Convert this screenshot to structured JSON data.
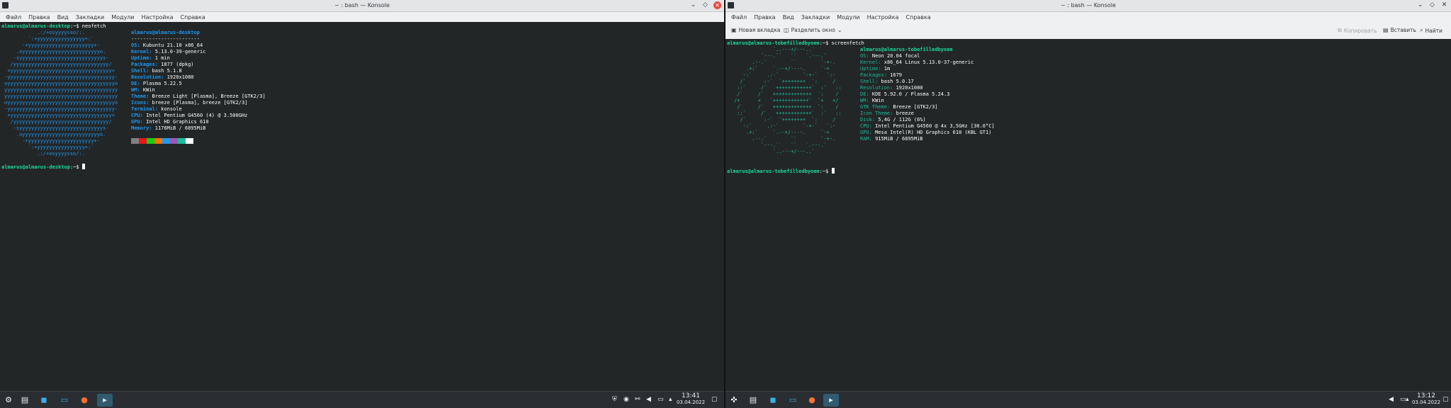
{
  "left_window": {
    "title": "~ : bash — Konsole",
    "menu": [
      "Файл",
      "Правка",
      "Вид",
      "Закладки",
      "Модули",
      "Настройка",
      "Справка"
    ],
    "prompt_user": "almarus@almarus-desktop",
    "prompt_suffix": ":~$ ",
    "command": "neofetch",
    "header_user": "almarus@almarus-desktop",
    "separator": "-----------------------",
    "info": [
      {
        "key": "OS",
        "value": "Kubuntu 21.10 x86_64"
      },
      {
        "key": "Kernel",
        "value": "5.13.0-39-generic"
      },
      {
        "key": "Uptime",
        "value": "1 min"
      },
      {
        "key": "Packages",
        "value": "1877 (dpkg)"
      },
      {
        "key": "Shell",
        "value": "bash 5.1.8"
      },
      {
        "key": "Resolution",
        "value": "1920x1080"
      },
      {
        "key": "DE",
        "value": "Plasma 5.22.5"
      },
      {
        "key": "WM",
        "value": "KWin"
      },
      {
        "key": "Theme",
        "value": "Breeze Light [Plasma], Breeze [GTK2/3]"
      },
      {
        "key": "Icons",
        "value": "breeze [Plasma], breeze [GTK2/3]"
      },
      {
        "key": "Terminal",
        "value": "konsole"
      },
      {
        "key": "CPU",
        "value": "Intel Pentium G4560 (4) @ 3.500GHz"
      },
      {
        "key": "GPU",
        "value": "Intel HD Graphics 610"
      },
      {
        "key": "Memory",
        "value": "1176MiB / 6895MiB"
      }
    ],
    "ascii_art": [
      "           .:/+osyyyysso/:.",
      "        `:+yyyyyyyyyyyyyyyy+:`",
      "      -+yyyyyyyyyyyyyyyyyyyyyy+-",
      "    .oyyyyyyyyyyyyyyyyyyyyyyyyyyo.",
      "   -syyyyyyyyyyyyyyyyyyyyyyyyyyyys-",
      "  /yyyyyyyyyyyyyyyyyyyyyyyyyyyyyyyy/",
      " +yyyyyyyyyyyyyyyyyyyyyyyyyyyyyyyyyy+",
      "-yyyyyyyyyyyyyyyyyyyyyyyyyyyyyyyyyyyy-",
      "oyyyyyyyyyyyyyyyyyyyyyyyyyyyyyyyyyyyyo",
      "yyyyyyyyyyyyyyyyyyyyyyyyyyyyyyyyyyyyyy",
      "yyyyyyyyyyyyyyyyyyyyyyyyyyyyyyyyyyyyyy",
      "oyyyyyyyyyyyyyyyyyyyyyyyyyyyyyyyyyyyyo",
      "-yyyyyyyyyyyyyyyyyyyyyyyyyyyyyyyyyyyy-",
      " +yyyyyyyyyyyyyyyyyyyyyyyyyyyyyyyyyy+",
      "  /yyyyyyyyyyyyyyyyyyyyyyyyyyyyyyyy/",
      "   -syyyyyyyyyyyyyyyyyyyyyyyyyyyys-",
      "    .oyyyyyyyyyyyyyyyyyyyyyyyyyyo.",
      "      -+yyyyyyyyyyyyyyyyyyyyyy+-",
      "        `:+yyyyyyyyyyyyyyyy+:`",
      "           .:/+osyyyysso/:."
    ],
    "palette": [
      "#808080",
      "#ed1515",
      "#11d116",
      "#f67400",
      "#1d99f3",
      "#9b59b6",
      "#1abc9c",
      "#fcfcfc"
    ]
  },
  "right_window": {
    "title": "~ : bash — Konsole",
    "menu": [
      "Файл",
      "Правка",
      "Вид",
      "Закладки",
      "Модули",
      "Настройка",
      "Справка"
    ],
    "toolbar": {
      "new_tab": "Новая вкладка",
      "split": "Разделить окно",
      "copy": "Копировать",
      "paste": "Вставить",
      "find": "Найти"
    },
    "prompt_user": "almarus@almarus-tobefilledbyoem",
    "prompt_suffix": ":~$ ",
    "command": "screenfetch",
    "header_user": "almarus@almarus-tobefilledbyoem",
    "info": [
      {
        "key": "OS",
        "value": "Neon 20.04 focal"
      },
      {
        "key": "Kernel",
        "value": "x86_64 Linux 5.13.0-37-generic"
      },
      {
        "key": "Uptime",
        "value": "1m"
      },
      {
        "key": "Packages",
        "value": "1679"
      },
      {
        "key": "Shell",
        "value": "bash 5.0.17"
      },
      {
        "key": "Resolution",
        "value": "1920x1080"
      },
      {
        "key": "DE",
        "value": "KDE 5.92.0 / Plasma 5.24.3"
      },
      {
        "key": "WM",
        "value": "KWin"
      },
      {
        "key": "GTK Theme",
        "value": "Breeze [GTK2/3]"
      },
      {
        "key": "Icon Theme",
        "value": "breeze"
      },
      {
        "key": "Disk",
        "value": "5,4G / 112G (6%)"
      },
      {
        "key": "CPU",
        "value": "Intel Pentium G4560 @ 4x 3,5GHz [30.0°C]"
      },
      {
        "key": "GPU",
        "value": "Mesa Intel(R) HD Graphics 610 (KBL GT1)"
      },
      {
        "key": "RAM",
        "value": "915MiB / 6895MiB"
      }
    ],
    "ascii_art": [
      "             `..---+/---..`",
      "         `---.``   ``   `.---.`",
      "      .--.`        ``        `-+-.",
      "    .+:`     `.--+/----.     `-+",
      "   -:`     .:-`        `-+-`   `:-",
      "  /`      :-`  `++++++++  `:     /",
      " ::`     /`   ++++++++++++`  :`   ::",
      " /`     /`   +++++++++++++  `:    /",
      "/+      +   `++++++++++++`  `+   +/",
      " /`     /`   +++++++++++++  `:    /",
      " ::`     /`   ++++++++++++`  :`   ::",
      "  /`      :-`  `++++++++  `:     /",
      "   -:`     .:-`        `-+-`   `:-",
      "    .+:`     `.--+/----.     `-+",
      "      .--.`        ``        `-+-.",
      "         `---.``   ``   `.---.`",
      "             `..---+/---..`"
    ]
  },
  "taskbar_left": {
    "time": "13:41",
    "date": "03.04.2022"
  },
  "taskbar_right": {
    "time": "13:12",
    "date": "03.04.2022"
  }
}
